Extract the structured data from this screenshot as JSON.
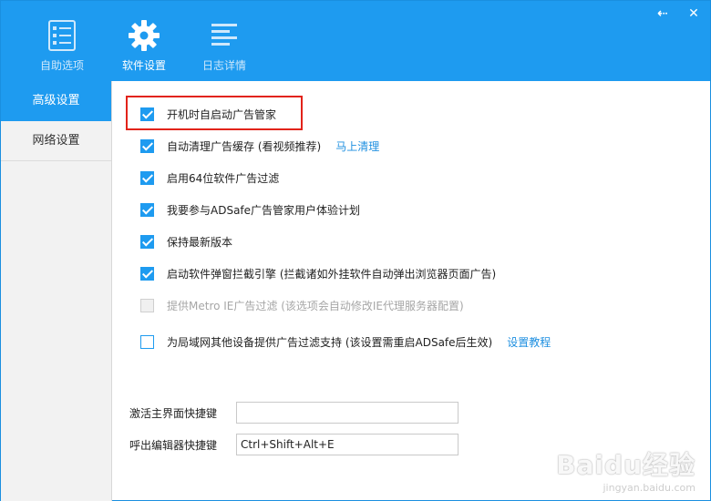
{
  "window": {
    "controls": {
      "back": "⇠",
      "close": "✕"
    }
  },
  "nav": {
    "tabs": [
      {
        "label": "自助选项",
        "icon": "checklist-icon"
      },
      {
        "label": "软件设置",
        "icon": "gear-icon"
      },
      {
        "label": "日志详情",
        "icon": "log-lines-icon"
      }
    ],
    "active": "软件设置"
  },
  "sidebar": {
    "items": [
      {
        "label": "高级设置"
      },
      {
        "label": "网络设置"
      }
    ],
    "active": "高级设置"
  },
  "options": [
    {
      "label": "开机时自启动广告管家",
      "checked": true,
      "enabled": true
    },
    {
      "label": "自动清理广告缓存 (看视频推荐)",
      "checked": true,
      "enabled": true,
      "link": "马上清理"
    },
    {
      "label": "启用64位软件广告过滤",
      "checked": true,
      "enabled": true
    },
    {
      "label": "我要参与ADSafe广告管家用户体验计划",
      "checked": true,
      "enabled": true
    },
    {
      "label": "保持最新版本",
      "checked": true,
      "enabled": true
    },
    {
      "label": "启动软件弹窗拦截引擎 (拦截诸如外挂软件自动弹出浏览器页面广告)",
      "checked": true,
      "enabled": true
    },
    {
      "label": "提供Metro IE广告过滤 (该选项会自动修改IE代理服务器配置)",
      "checked": false,
      "enabled": false
    },
    {
      "label": "为局域网其他设备提供广告过滤支持 (该设置需重启ADSafe后生效)",
      "checked": false,
      "enabled": true,
      "link": "设置教程"
    }
  ],
  "hotkeys": {
    "activate_label": "激活主界面快捷键",
    "activate_value": "",
    "editor_label": "呼出编辑器快捷键",
    "editor_value": "Ctrl+Shift+Alt+E"
  },
  "watermark": {
    "main": "Baidu经验",
    "sub": "jingyan.baidu.com"
  },
  "colors": {
    "accent": "#1e9bf0",
    "highlight": "#e2231a",
    "sidebar_bg": "#f2f2f2"
  }
}
